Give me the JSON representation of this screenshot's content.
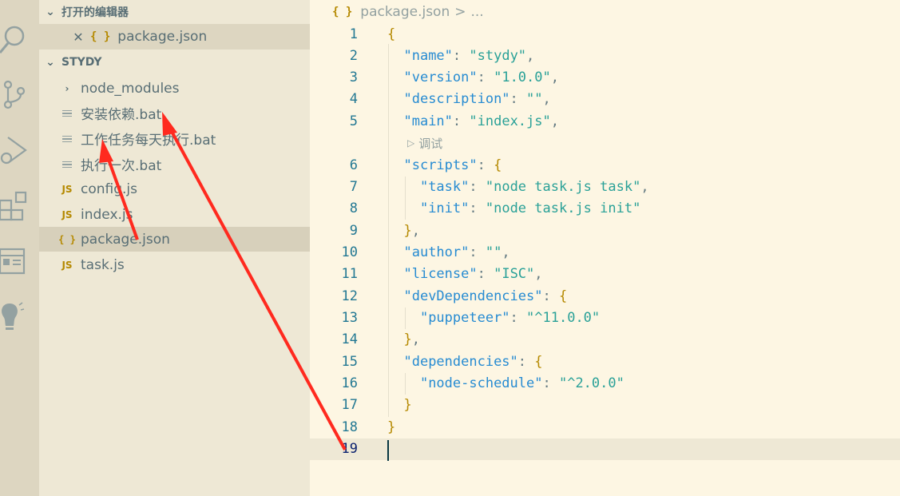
{
  "sidebar": {
    "open_editors_label": "打开的编辑器",
    "open_editor_file": "package.json",
    "project_label": "STYDY",
    "items": [
      {
        "label": "node_modules",
        "icon": "chevron-right-icon"
      },
      {
        "label": "安装依赖.bat",
        "icon": "file-lines-icon"
      },
      {
        "label": "工作任务每天执行.bat",
        "icon": "file-lines-icon"
      },
      {
        "label": "执行一次.bat",
        "icon": "file-lines-icon"
      },
      {
        "label": "config.js",
        "icon": "js-icon"
      },
      {
        "label": "index.js",
        "icon": "js-icon"
      },
      {
        "label": "package.json",
        "icon": "json-icon",
        "selected": true
      },
      {
        "label": "task.js",
        "icon": "js-icon"
      }
    ],
    "js_badge": "JS",
    "json_badge": "{ }"
  },
  "editor": {
    "breadcrumb_file": "package.json",
    "breadcrumb_sep": ">",
    "breadcrumb_more": "...",
    "codelens": "调试",
    "line_numbers": [
      "1",
      "2",
      "3",
      "4",
      "5",
      "6",
      "7",
      "8",
      "9",
      "10",
      "11",
      "12",
      "13",
      "14",
      "15",
      "16",
      "17",
      "18",
      "19"
    ],
    "current_line": "19"
  },
  "colors": {
    "background": "#fdf6e3",
    "sidebar": "#eee8d5",
    "activity_bar": "#ddd6c1",
    "key": "#268bd2",
    "string": "#2aa198",
    "bracket": "#b58900",
    "annotation_arrow": "#ff2a1f"
  }
}
